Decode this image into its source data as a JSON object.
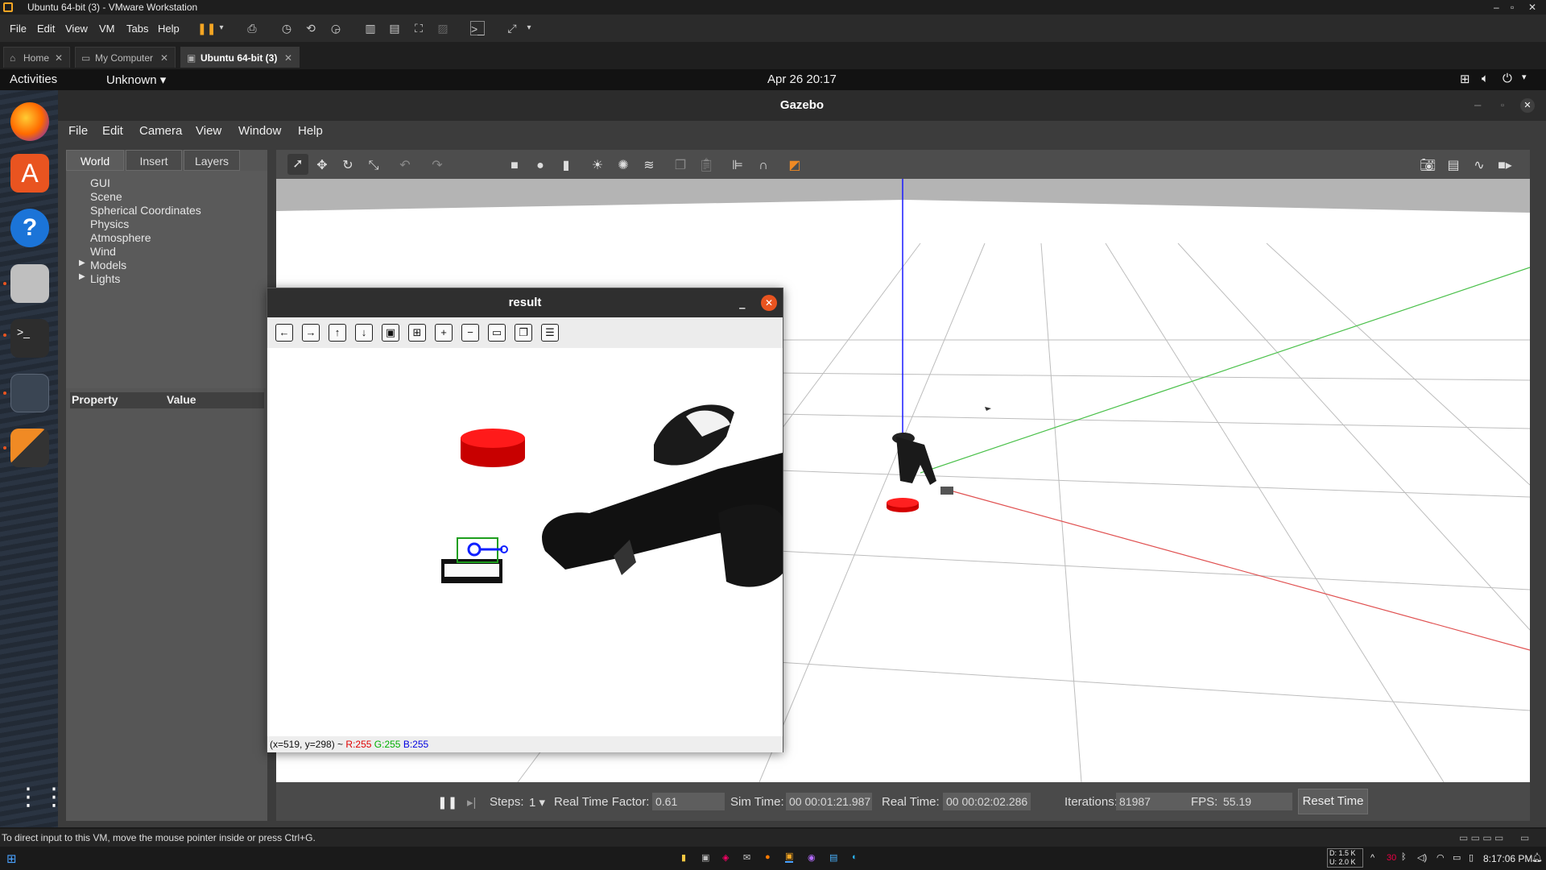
{
  "vmware": {
    "title": "Ubuntu 64-bit (3) - VMware Workstation",
    "menu": [
      "File",
      "Edit",
      "View",
      "VM",
      "Tabs",
      "Help"
    ],
    "tabs": [
      {
        "label": "Home",
        "icon": "home-icon"
      },
      {
        "label": "My Computer",
        "icon": "computer-icon"
      },
      {
        "label": "Ubuntu 64-bit (3)",
        "icon": "vm-icon",
        "active": true
      }
    ],
    "hint": "To direct input to this VM, move the mouse pointer inside or press Ctrl+G."
  },
  "ubuntu": {
    "activities": "Activities",
    "app_menu": "Unknown",
    "clock": "Apr 26  20:17"
  },
  "gazebo": {
    "title": "Gazebo",
    "menu": [
      "File",
      "Edit",
      "Camera",
      "View",
      "Window",
      "Help"
    ],
    "left_tabs": [
      "World",
      "Insert",
      "Layers"
    ],
    "world_items": [
      "GUI",
      "Scene",
      "Spherical Coordinates",
      "Physics",
      "Atmosphere",
      "Wind",
      "Models",
      "Lights"
    ],
    "prop_header": {
      "property": "Property",
      "value": "Value"
    },
    "bottom": {
      "steps_label": "Steps:",
      "steps_value": "1",
      "rtf_label": "Real Time Factor:",
      "rtf_value": "0.61",
      "sim_label": "Sim Time:",
      "sim_value": "00 00:01:21.987",
      "real_label": "Real Time:",
      "real_value": "00 00:02:02.286",
      "iter_label": "Iterations:",
      "iter_value": "81987",
      "fps_label": "FPS:",
      "fps_value": "55.19",
      "reset": "Reset Time"
    }
  },
  "result": {
    "title": "result",
    "status_prefix": "(x=519, y=298) ~ ",
    "r": "R:255",
    "g": "G:255",
    "b": "B:255"
  },
  "taskbar": {
    "net_down": "D: 1.5 K",
    "net_up": "U: 2.0 K",
    "time": "8:17:06 PM",
    "badge": "30"
  },
  "colors": {
    "ubuntu_orange": "#e95420",
    "gazebo_bg": "#565656",
    "accent_red": "#e00000"
  }
}
